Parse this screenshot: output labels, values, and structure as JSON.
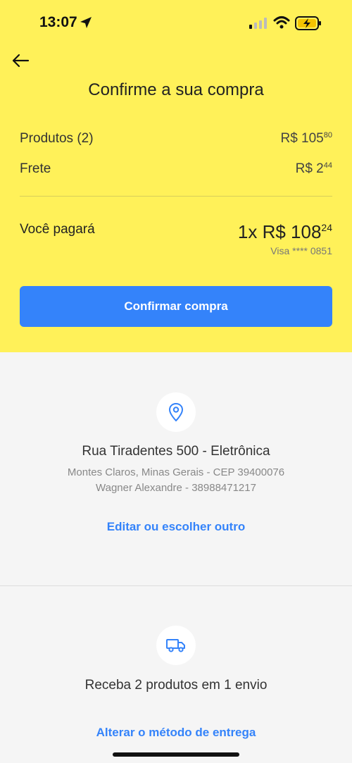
{
  "status": {
    "time": "13:07"
  },
  "header": {
    "title": "Confirme a sua compra"
  },
  "summary": {
    "products_label": "Produtos (2)",
    "products_currency": "R$ 105",
    "products_cents": "80",
    "shipping_label": "Frete",
    "shipping_currency": "R$ 2",
    "shipping_cents": "44",
    "pay_label": "Você pagará",
    "pay_total": "1x R$ 108",
    "pay_cents": "24",
    "card": "Visa **** 0851"
  },
  "actions": {
    "confirm_label": "Confirmar compra"
  },
  "address": {
    "title": "Rua Tiradentes 500 - Eletrônica",
    "city_line": "Montes Claros, Minas Gerais - CEP 39400076",
    "recipient_line": "Wagner Alexandre - 38988471217",
    "edit_label": "Editar ou escolher outro"
  },
  "delivery": {
    "title": "Receba 2 produtos em 1 envio",
    "change_label": "Alterar o método de entrega"
  },
  "colors": {
    "accent": "#3483fa",
    "header_bg": "#fff159",
    "page_bg": "#f5f5f5"
  }
}
